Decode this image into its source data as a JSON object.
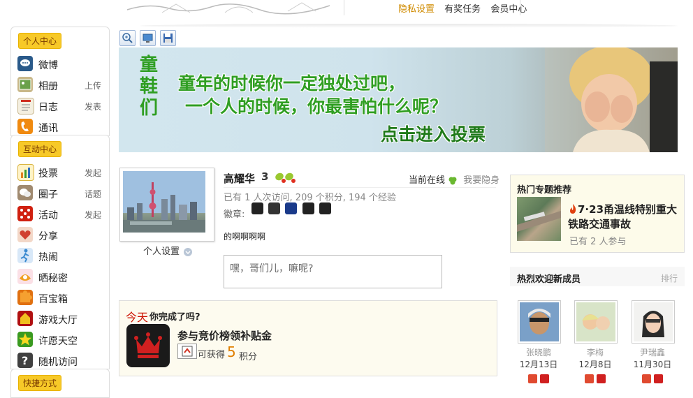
{
  "header": {
    "links": [
      "隐私设置",
      "有奖任务",
      "会员中心"
    ]
  },
  "sidebar": {
    "personal_title": "个人中心",
    "personal_items": [
      {
        "label": "微博",
        "sub": "",
        "icon": "weibo-icon",
        "color": "#2a5a8a"
      },
      {
        "label": "相册",
        "sub": "上传",
        "icon": "album-icon",
        "color": "#5a8a3a"
      },
      {
        "label": "日志",
        "sub": "发表",
        "icon": "journal-icon",
        "color": "#e8e0c8"
      },
      {
        "label": "通讯",
        "sub": "",
        "icon": "phone-icon",
        "color": "#f08a10"
      }
    ],
    "interact_title": "互动中心",
    "interact_items": [
      {
        "label": "投票",
        "sub": "发起",
        "icon": "vote-icon",
        "color": "#e8b030"
      },
      {
        "label": "圈子",
        "sub": "话题",
        "icon": "group-icon",
        "color": "#a08a70"
      },
      {
        "label": "活动",
        "sub": "发起",
        "icon": "dice-icon",
        "color": "#d02010"
      },
      {
        "label": "分享",
        "sub": "",
        "icon": "heart-icon",
        "color": "#d05a50"
      },
      {
        "label": "热闹",
        "sub": "",
        "icon": "runner-icon",
        "color": "#3a8ad0"
      },
      {
        "label": "晒秘密",
        "sub": "",
        "icon": "secret-icon",
        "color": "#f0b0c0"
      },
      {
        "label": "百宝箱",
        "sub": "",
        "icon": "puzzle-icon",
        "color": "#e07010"
      },
      {
        "label": "游戏大厅",
        "sub": "",
        "icon": "game-icon",
        "color": "#b01010"
      },
      {
        "label": "许愿天空",
        "sub": "",
        "icon": "star-icon",
        "color": "#3a9a20"
      },
      {
        "label": "随机访问",
        "sub": "",
        "icon": "random-icon",
        "color": "#404040"
      }
    ],
    "shortcut_title": "快捷方式"
  },
  "banner": {
    "vertical": [
      "童",
      "鞋",
      "们"
    ],
    "line1": "童年的时候你一定独处过吧，",
    "line2": "一个人的时候，你最害怕什么呢？",
    "cta": "点击进入投票"
  },
  "profile": {
    "settings_label": "个人设置",
    "name": "高耀华",
    "level": "3",
    "online_label": "当前在线",
    "hide_label": "我要隐身",
    "stats": "已有 1 人次访问, 209 个积分, 194 个经验",
    "badges_label": "徽章:",
    "status_text": "的啊啊啊啊",
    "input_placeholder": "嘿，哥们儿，嘛呢?"
  },
  "task": {
    "today": "今天",
    "question": "你完成了吗?",
    "title": "参与竞价榜领补贴金",
    "reward_prefix": "可获得",
    "points": "5",
    "unit": "积分"
  },
  "hot": {
    "title": "热门专题推荐",
    "headline": "7·23甬温线特别重大铁路交通事故",
    "meta": "已有 2 人参与"
  },
  "new_members": {
    "title": "热烈欢迎新成员",
    "rank_label": "排行",
    "members": [
      {
        "name": "张晓鹏",
        "date": "12月13日"
      },
      {
        "name": "李梅",
        "date": "12月8日"
      },
      {
        "name": "尹瑞鑫",
        "date": "11月30日"
      }
    ]
  }
}
